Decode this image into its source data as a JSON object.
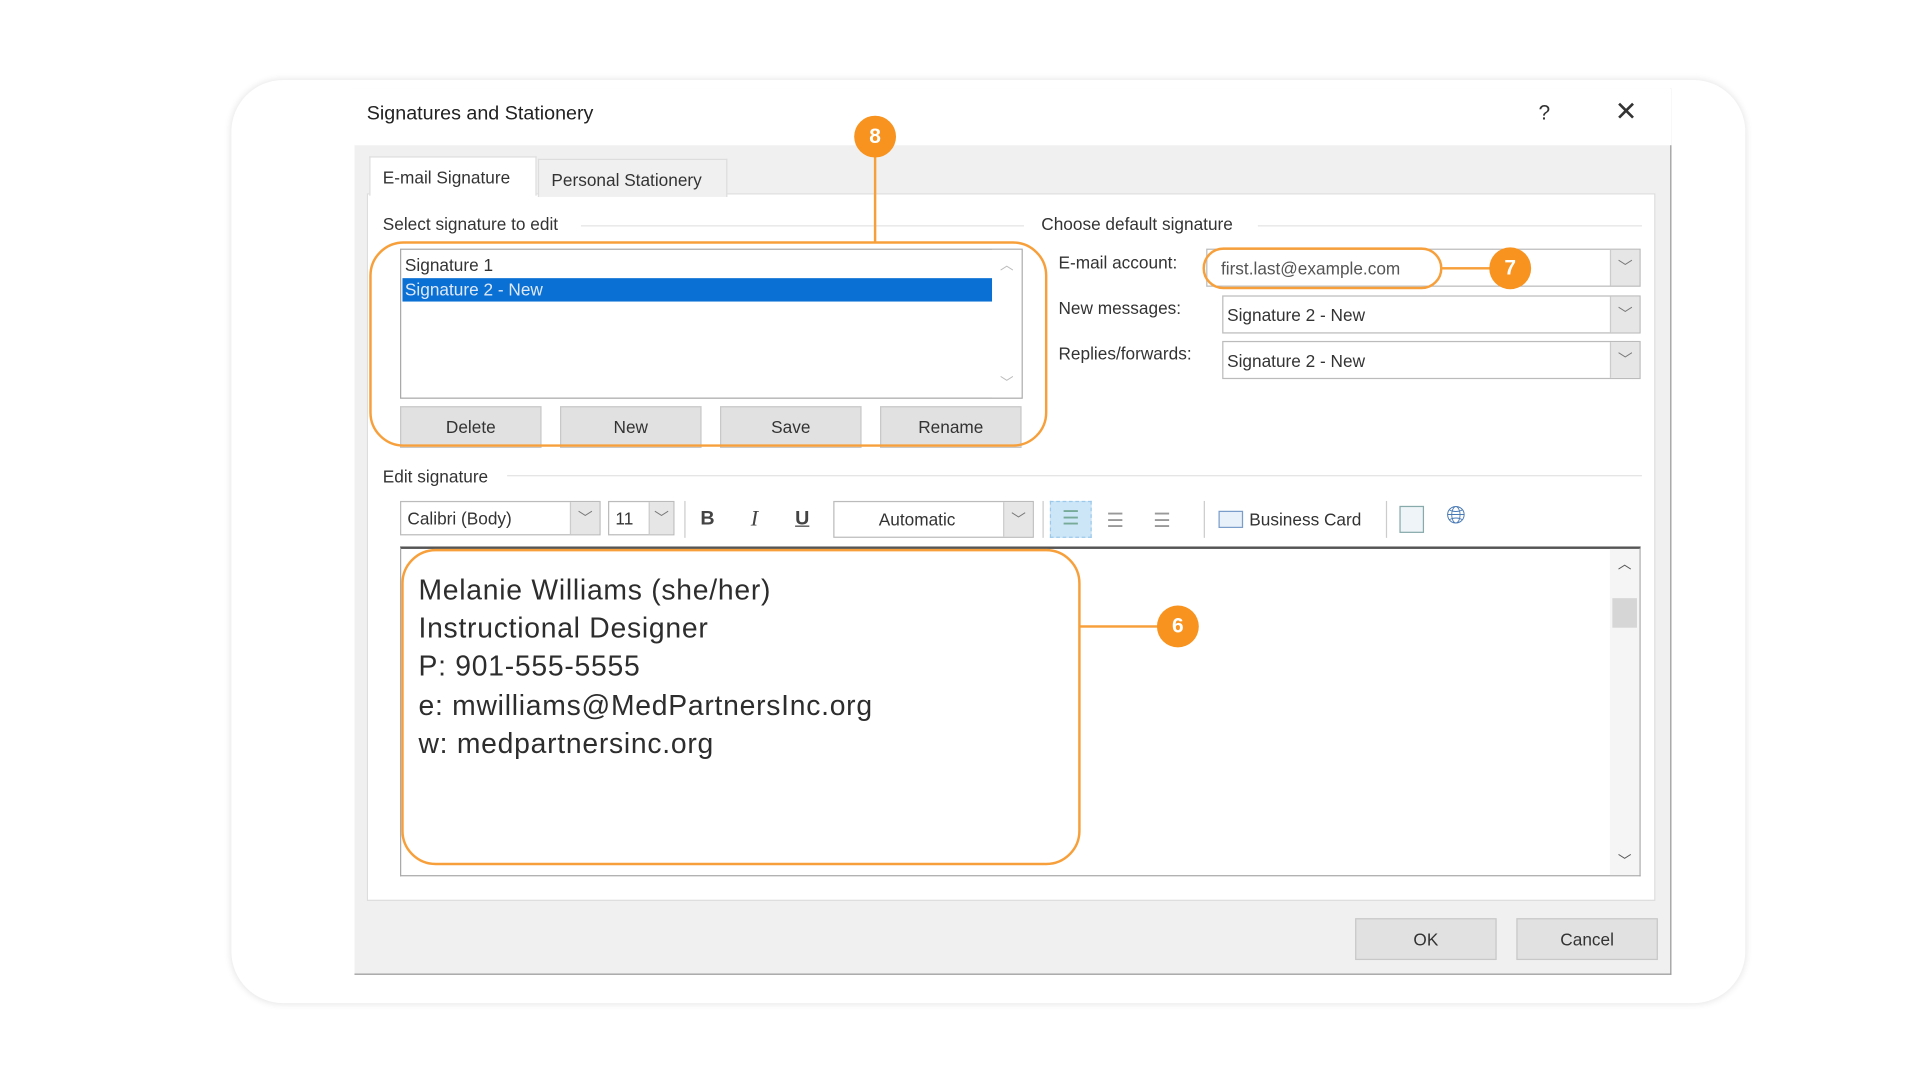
{
  "dialog": {
    "title": "Signatures and Stationery",
    "help_label": "?",
    "close_label": "✕"
  },
  "tabs": [
    {
      "label": "E-mail Signature",
      "active": true
    },
    {
      "label": "Personal Stationery",
      "active": false
    }
  ],
  "select_section": {
    "label": "Select signature to edit",
    "items": [
      {
        "label": "Signature 1",
        "selected": false
      },
      {
        "label": "Signature 2 - New",
        "selected": true
      }
    ],
    "buttons": {
      "delete": "Delete",
      "new": "New",
      "save": "Save",
      "rename": "Rename"
    }
  },
  "default_section": {
    "label": "Choose default signature",
    "email_account": {
      "label": "E-mail account:",
      "value": "first.last@example.com"
    },
    "new_messages": {
      "label": "New messages:",
      "value": "Signature 2 - New"
    },
    "replies": {
      "label": "Replies/forwards:",
      "value": "Signature 2 - New"
    }
  },
  "edit_section": {
    "label": "Edit signature",
    "toolbar": {
      "font": "Calibri (Body)",
      "size": "11",
      "bold": "B",
      "italic": "I",
      "underline": "U",
      "color": "Automatic",
      "business_card": "Business Card"
    },
    "signature_lines": [
      "Melanie Williams (she/her)",
      "Instructional Designer",
      "P: 901-555-5555",
      "e: mwilliams@MedPartnersInc.org",
      "w: medpartnersinc.org"
    ]
  },
  "footer": {
    "ok": "OK",
    "cancel": "Cancel"
  },
  "callouts": {
    "six": "6",
    "seven": "7",
    "eight": "8"
  },
  "colors": {
    "callout": "#f7931e",
    "selection": "#0a70d4"
  }
}
